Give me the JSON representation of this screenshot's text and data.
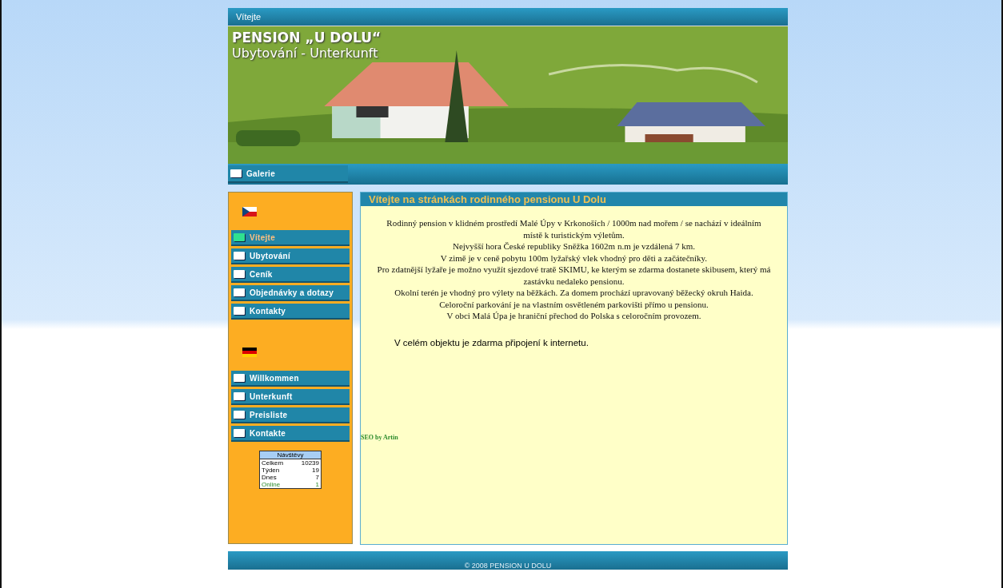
{
  "top_bar": {
    "title": "Vítejte"
  },
  "banner": {
    "kind": "picture",
    "title": "PENSION „U DOLU“",
    "subtitle": "Ubytování - Unterkunft"
  },
  "gallery_tab": {
    "label": "Galerie"
  },
  "sidebar": {
    "groups": [
      {
        "kind": "cz",
        "items": [
          {
            "label": "Vítejte",
            "selected": true
          },
          {
            "label": "Ubytování",
            "selected": false
          },
          {
            "label": "Ceník",
            "selected": false
          },
          {
            "label": "Objednávky a dotazy",
            "selected": false
          },
          {
            "label": "Kontakty",
            "selected": false
          }
        ]
      },
      {
        "kind": "de",
        "items": [
          {
            "label": "Willkommen",
            "selected": false
          },
          {
            "label": "Unterkunft",
            "selected": false
          },
          {
            "label": "Preisliste",
            "selected": false
          },
          {
            "label": "Kontakte",
            "selected": false
          }
        ]
      }
    ],
    "counter": {
      "title": "Návštěvy",
      "rows": [
        {
          "label": "Celkem",
          "value": "10239",
          "kind": "plain"
        },
        {
          "label": "Týden",
          "value": "19",
          "kind": "plain"
        },
        {
          "label": "Dnes",
          "value": "7",
          "kind": "plain"
        },
        {
          "label": "Online",
          "value": "1",
          "kind": "online"
        }
      ]
    }
  },
  "content": {
    "heading": "Vítejte na stránkách rodinného pensionu U Dolu",
    "paragraph_lines": [
      "Rodinný pension v klidném prostředí Malé Úpy v Krkonoších / 1000m nad mořem / se nachází v ideálním místě k turistickým výletům.",
      "Nejvyšší hora České republiky Sněžka 1602m n.m je vzdálená 7 km.",
      "V zimě je v ceně pobytu 100m lyžařský vlek vhodný pro děti a začátečníky.",
      "Pro zdatnější lyžaře je možno využít sjezdové tratě SKIMU, ke kterým se zdarma dostanete skibusem, který má zastávku nedaleko pensionu.",
      "Okolní terén je vhodný pro výlety na běžkách. Za domem prochází upravovaný běžecký okruh Haida.",
      "Celoroční parkování je na vlastním osvětleném parkovišti přímo u pensionu.",
      "V obci Malá Úpa je hraniční přechod do Polska s celoročním provozem."
    ],
    "internet_note": "V celém objektu je zdarma připojení k internetu.",
    "seo_link": "SEO by Artin"
  },
  "footer": {
    "copyright": "© 2008 PENSION U DOLU"
  }
}
